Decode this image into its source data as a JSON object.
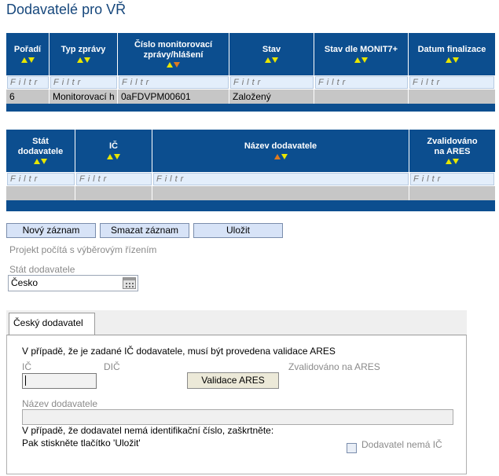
{
  "page": {
    "title": "Dodavatelé pro VŘ"
  },
  "grid1": {
    "columns": [
      "Pořadí",
      "Typ zprávy",
      "Číslo monitorovací zprávy/hlášení",
      "Stav",
      "Stav dle MONIT7+",
      "Datum finalizace"
    ],
    "filter_placeholder": "Filtr",
    "rows": [
      [
        "6",
        "Monitorovací h",
        "0aFDVPM00601",
        "Založený",
        "",
        ""
      ]
    ]
  },
  "grid2": {
    "columns": [
      "Stát dodavatele",
      "IČ",
      "Název dodavatele",
      "Zvalidováno na ARES"
    ],
    "filter_placeholder": "Filtr",
    "rows": [
      [
        "",
        "",
        "",
        ""
      ]
    ]
  },
  "toolbar": {
    "new_label": "Nový záznam",
    "delete_label": "Smazat záznam",
    "save_label": "Uložit"
  },
  "form": {
    "project_note": "Projekt počítá s výběrovým řízením",
    "country_label": "Stát dodavatele",
    "country_value": "Česko",
    "tab_label": "Český dodavatel",
    "ares_note": "V případě, že je zadané IČ dodavatele, musí být provedena validace ARES",
    "ic_label": "IČ",
    "dic_label": "DIČ",
    "validated_label": "Zvalidováno na ARES",
    "validate_button": "Validace ARES",
    "name_label": "Název dodavatele",
    "no_ic_note1": "V případě, že dodavatel nemá identifikační číslo, zaškrtněte:",
    "no_ic_note2": "Pak stiskněte tlačítko 'Uložit'",
    "no_ic_checkbox_label": "Dodavatel nemá IČ"
  },
  "colors": {
    "header_bg": "#0c4e8f",
    "title": "#16477c",
    "sort_arrow": "#e8e600",
    "sort_active": "#e07a1f"
  }
}
